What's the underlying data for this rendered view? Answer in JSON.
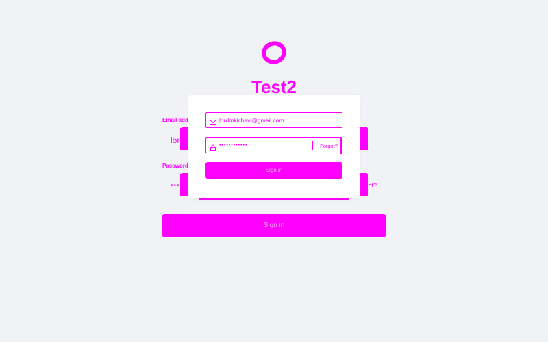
{
  "app": {
    "title": "Test2",
    "logo_icon": "ring-logo-icon"
  },
  "form": {
    "email_label": "Email address",
    "email_value": "lordmkichavi@gmail.com",
    "password_label": "Password",
    "password_dots": "••••••••••••",
    "forgot_label": "Forgot?",
    "signin_label": "Sign in"
  },
  "colors": {
    "accent": "#ff00ff",
    "background": "#f1f2f6",
    "card": "#ffffff"
  }
}
